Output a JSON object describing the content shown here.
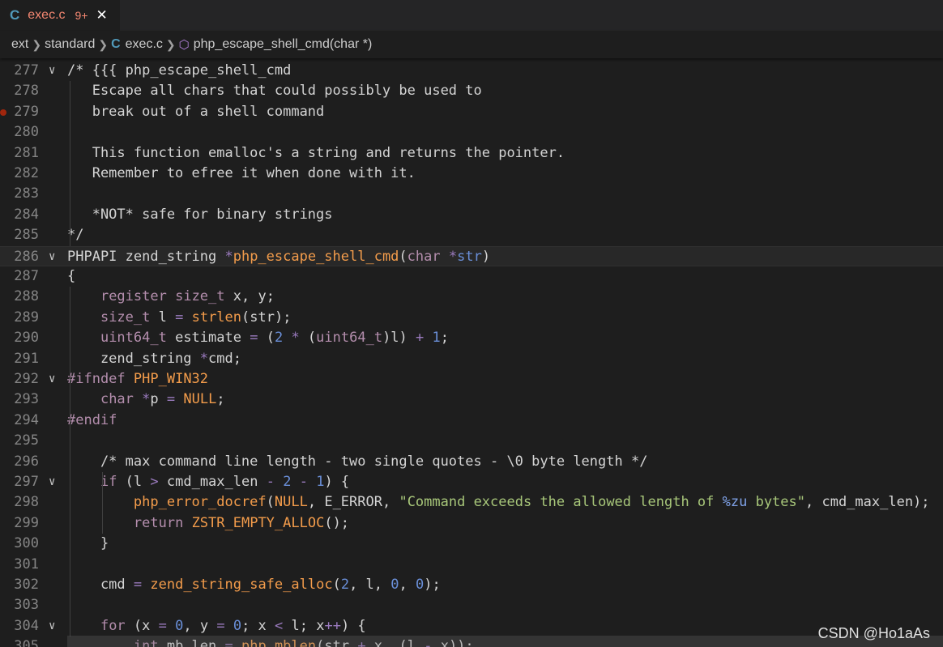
{
  "tab": {
    "lang_icon": "C",
    "filename": "exec.c",
    "problems": "9+",
    "close_glyph": "✕"
  },
  "breadcrumb": {
    "part1": "ext",
    "part2": "standard",
    "file_icon": "C",
    "file": "exec.c",
    "symbol_icon": "cube-icon",
    "symbol": "php_escape_shell_cmd(char *)"
  },
  "editor": {
    "current_line": 286,
    "breakpoint_line": 279,
    "lines": [
      {
        "n": "277",
        "fold": true,
        "tokens": [
          [
            "c",
            "/* {{{ php_escape_shell_cmd"
          ]
        ]
      },
      {
        "n": "278",
        "fold": false,
        "tokens": [
          [
            "c",
            "   Escape all chars that could possibly be used to"
          ]
        ]
      },
      {
        "n": "279",
        "fold": false,
        "tokens": [
          [
            "c",
            "   break out of a shell command"
          ]
        ]
      },
      {
        "n": "280",
        "fold": false,
        "tokens": []
      },
      {
        "n": "281",
        "fold": false,
        "tokens": [
          [
            "c",
            "   This function emalloc's a string and returns the pointer."
          ]
        ]
      },
      {
        "n": "282",
        "fold": false,
        "tokens": [
          [
            "c",
            "   Remember to efree it when done with it."
          ]
        ]
      },
      {
        "n": "283",
        "fold": false,
        "tokens": []
      },
      {
        "n": "284",
        "fold": false,
        "tokens": [
          [
            "c",
            "   *NOT* safe for binary strings"
          ]
        ]
      },
      {
        "n": "285",
        "fold": false,
        "tokens": [
          [
            "c",
            "*/"
          ]
        ]
      },
      {
        "n": "286",
        "fold": true,
        "tokens": [
          [
            "i",
            "PHPAPI zend_string "
          ],
          [
            "o",
            "*"
          ],
          [
            "f",
            "php_escape_shell_cmd"
          ],
          [
            "i",
            "("
          ],
          [
            "t",
            "char"
          ],
          [
            "i",
            " "
          ],
          [
            "o",
            "*"
          ],
          [
            "n",
            "str"
          ],
          [
            "i",
            ")"
          ]
        ]
      },
      {
        "n": "287",
        "fold": false,
        "tokens": [
          [
            "i",
            "{"
          ]
        ]
      },
      {
        "n": "288",
        "fold": false,
        "tokens": [
          [
            "i",
            "    "
          ],
          [
            "k",
            "register"
          ],
          [
            "i",
            " "
          ],
          [
            "t",
            "size_t"
          ],
          [
            "i",
            " x, y;"
          ]
        ]
      },
      {
        "n": "289",
        "fold": false,
        "tokens": [
          [
            "i",
            "    "
          ],
          [
            "t",
            "size_t"
          ],
          [
            "i",
            " l "
          ],
          [
            "o",
            "="
          ],
          [
            "i",
            " "
          ],
          [
            "f",
            "strlen"
          ],
          [
            "i",
            "(str);"
          ]
        ]
      },
      {
        "n": "290",
        "fold": false,
        "tokens": [
          [
            "i",
            "    "
          ],
          [
            "t",
            "uint64_t"
          ],
          [
            "i",
            " estimate "
          ],
          [
            "o",
            "="
          ],
          [
            "i",
            " ("
          ],
          [
            "n",
            "2"
          ],
          [
            "i",
            " "
          ],
          [
            "o",
            "*"
          ],
          [
            "i",
            " ("
          ],
          [
            "t",
            "uint64_t"
          ],
          [
            "i",
            ")l) "
          ],
          [
            "o",
            "+"
          ],
          [
            "i",
            " "
          ],
          [
            "n",
            "1"
          ],
          [
            "i",
            ";"
          ]
        ]
      },
      {
        "n": "291",
        "fold": false,
        "tokens": [
          [
            "i",
            "    zend_string "
          ],
          [
            "o",
            "*"
          ],
          [
            "i",
            "cmd;"
          ]
        ]
      },
      {
        "n": "292",
        "fold": true,
        "tokens": [
          [
            "p",
            "#ifndef"
          ],
          [
            "i",
            " "
          ],
          [
            "m",
            "PHP_WIN32"
          ]
        ]
      },
      {
        "n": "293",
        "fold": false,
        "tokens": [
          [
            "i",
            "    "
          ],
          [
            "t",
            "char"
          ],
          [
            "i",
            " "
          ],
          [
            "o",
            "*"
          ],
          [
            "i",
            "p "
          ],
          [
            "o",
            "="
          ],
          [
            "i",
            " "
          ],
          [
            "m",
            "NULL"
          ],
          [
            "i",
            ";"
          ]
        ]
      },
      {
        "n": "294",
        "fold": false,
        "tokens": [
          [
            "p",
            "#endif"
          ]
        ]
      },
      {
        "n": "295",
        "fold": false,
        "tokens": []
      },
      {
        "n": "296",
        "fold": false,
        "tokens": [
          [
            "c",
            "    /* max command line length - two single quotes - \\0 byte length */"
          ]
        ]
      },
      {
        "n": "297",
        "fold": true,
        "tokens": [
          [
            "i",
            "    "
          ],
          [
            "k",
            "if"
          ],
          [
            "i",
            " (l "
          ],
          [
            "o",
            ">"
          ],
          [
            "i",
            " cmd_max_len "
          ],
          [
            "o",
            "-"
          ],
          [
            "i",
            " "
          ],
          [
            "n",
            "2"
          ],
          [
            "i",
            " "
          ],
          [
            "o",
            "-"
          ],
          [
            "i",
            " "
          ],
          [
            "n",
            "1"
          ],
          [
            "i",
            ") {"
          ]
        ]
      },
      {
        "n": "298",
        "fold": false,
        "tokens": [
          [
            "i",
            "        "
          ],
          [
            "f",
            "php_error_docref"
          ],
          [
            "i",
            "("
          ],
          [
            "m",
            "NULL"
          ],
          [
            "i",
            ", E_ERROR, "
          ],
          [
            "s",
            "\"Command exceeds the allowed length of "
          ],
          [
            "x",
            "%zu"
          ],
          [
            "s",
            " bytes\""
          ],
          [
            "i",
            ", cmd_max_len);"
          ]
        ]
      },
      {
        "n": "299",
        "fold": false,
        "tokens": [
          [
            "i",
            "        "
          ],
          [
            "k",
            "return"
          ],
          [
            "i",
            " "
          ],
          [
            "f",
            "ZSTR_EMPTY_ALLOC"
          ],
          [
            "i",
            "();"
          ]
        ]
      },
      {
        "n": "300",
        "fold": false,
        "tokens": [
          [
            "i",
            "    }"
          ]
        ]
      },
      {
        "n": "301",
        "fold": false,
        "tokens": []
      },
      {
        "n": "302",
        "fold": false,
        "tokens": [
          [
            "i",
            "    cmd "
          ],
          [
            "o",
            "="
          ],
          [
            "i",
            " "
          ],
          [
            "f",
            "zend_string_safe_alloc"
          ],
          [
            "i",
            "("
          ],
          [
            "n",
            "2"
          ],
          [
            "i",
            ", l, "
          ],
          [
            "n",
            "0"
          ],
          [
            "i",
            ", "
          ],
          [
            "n",
            "0"
          ],
          [
            "i",
            ");"
          ]
        ]
      },
      {
        "n": "303",
        "fold": false,
        "tokens": []
      },
      {
        "n": "304",
        "fold": true,
        "tokens": [
          [
            "i",
            "    "
          ],
          [
            "k",
            "for"
          ],
          [
            "i",
            " (x "
          ],
          [
            "o",
            "="
          ],
          [
            "i",
            " "
          ],
          [
            "n",
            "0"
          ],
          [
            "i",
            ", y "
          ],
          [
            "o",
            "="
          ],
          [
            "i",
            " "
          ],
          [
            "n",
            "0"
          ],
          [
            "i",
            "; x "
          ],
          [
            "o",
            "<"
          ],
          [
            "i",
            " l; x"
          ],
          [
            "o",
            "++"
          ],
          [
            "i",
            ") {"
          ]
        ]
      },
      {
        "n": "305",
        "fold": false,
        "tokens": [
          [
            "i",
            "        "
          ],
          [
            "t",
            "int"
          ],
          [
            "i",
            " mb_len "
          ],
          [
            "o",
            "="
          ],
          [
            "i",
            " "
          ],
          [
            "f",
            "php_mblen"
          ],
          [
            "i",
            "(str "
          ],
          [
            "o",
            "+"
          ],
          [
            "i",
            " x, (l "
          ],
          [
            "o",
            "-"
          ],
          [
            "i",
            " x));"
          ]
        ]
      }
    ]
  },
  "watermark": "CSDN @Ho1aAs"
}
